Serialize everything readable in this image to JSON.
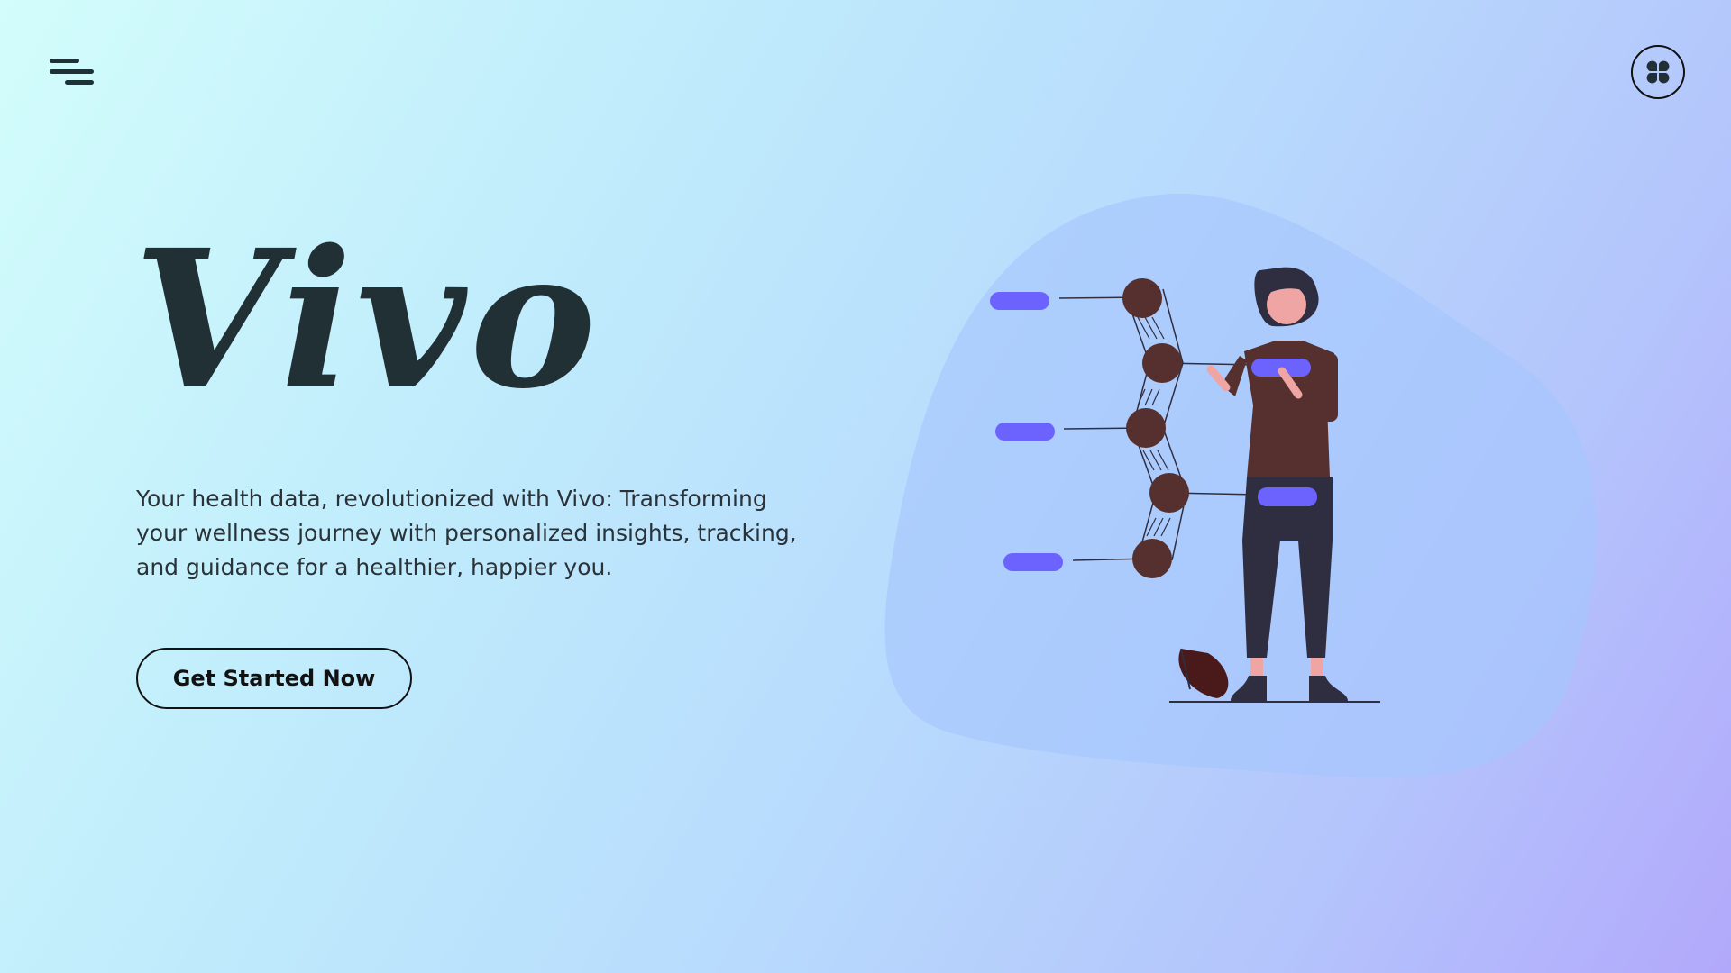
{
  "header": {
    "menu_icon": "hamburger-menu-icon",
    "logo_icon": "four-petal-logo-icon"
  },
  "hero": {
    "title": "Vivo",
    "description": "Your health data, revolutionized with Vivo: Transforming your wellness journey with personalized insights, tracking, and guidance for a healthier, happier you.",
    "cta_label": "Get Started Now"
  },
  "colors": {
    "accent": "#6c63ff",
    "text": "#213035",
    "figure_top": "#56302e",
    "figure_pants": "#2f2e41"
  }
}
